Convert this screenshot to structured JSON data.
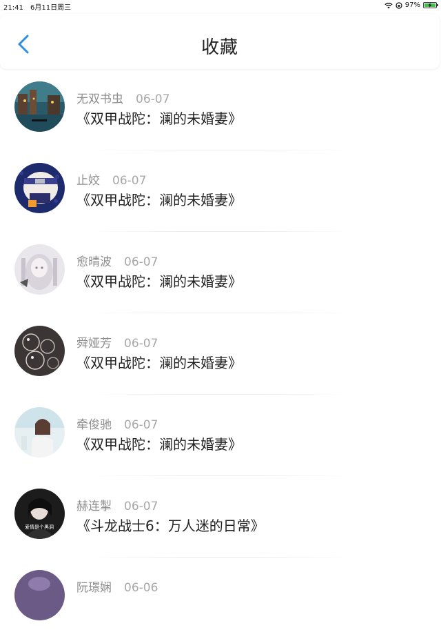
{
  "status": {
    "time": "21:41",
    "date": "6月11日周三",
    "battery_text": "97%",
    "battery_level": 0.97,
    "wifi_icon": "wifi-icon",
    "rotation_lock_icon": "rotation-lock-icon",
    "charging_icon": "charging-bolt-icon"
  },
  "header": {
    "title": "收藏",
    "back_icon": "chevron-left-icon",
    "accent_color": "#2b8fe6"
  },
  "items": [
    {
      "name": "无双书虫",
      "date": "06-07",
      "book": "《双甲战陀：澜的未婚妻》",
      "avatar": "avatar-venice"
    },
    {
      "name": "止姣",
      "date": "06-07",
      "book": "《双甲战陀：澜的未婚妻》",
      "avatar": "avatar-anime-ninja"
    },
    {
      "name": "愈晴波",
      "date": "06-07",
      "book": "《双甲战陀：澜的未婚妻》",
      "avatar": "avatar-anime-girl"
    },
    {
      "name": "舜娅芳",
      "date": "06-07",
      "book": "《双甲战陀：澜的未婚妻》",
      "avatar": "avatar-bubbles"
    },
    {
      "name": "牵俊驰",
      "date": "06-07",
      "book": "《双甲战陀：澜的未婚妻》",
      "avatar": "avatar-photo-girl"
    },
    {
      "name": "赫连掣",
      "date": "06-07",
      "book": "《斗龙战士6：万人迷的日常》",
      "avatar": "avatar-dark-portrait",
      "avatar_text": "爱情是个黑洞"
    },
    {
      "name": "阮璟娴",
      "date": "06-06",
      "book": "",
      "avatar": "avatar-purple"
    }
  ]
}
